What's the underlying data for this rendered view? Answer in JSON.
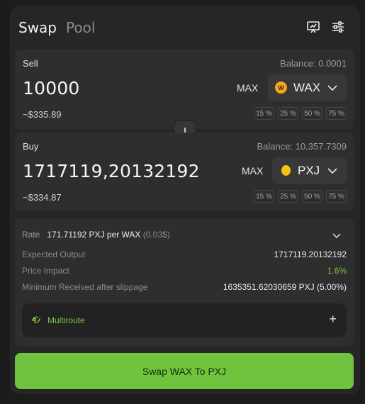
{
  "header": {
    "tab_swap": "Swap",
    "tab_pool": "Pool",
    "icons": [
      "chart-icon",
      "settings-icon"
    ]
  },
  "sell": {
    "label": "Sell",
    "balance": "Balance: 0.0001",
    "amount": "10000",
    "usd": "~$335.89",
    "max": "MAX",
    "token": "WAX",
    "token_icon_text": "W",
    "token_color": "#f5a623",
    "percents": [
      "15 %",
      "25 %",
      "50 %",
      "75 %"
    ]
  },
  "buy": {
    "label": "Buy",
    "balance": "Balance: 10,357.7309",
    "amount": "1717119,20132192",
    "usd": "~$334.87",
    "max": "MAX",
    "token": "PXJ",
    "token_color": "#f3c316",
    "percents": [
      "15 %",
      "25 %",
      "50 %",
      "75 %"
    ]
  },
  "details": {
    "rate_label": "Rate",
    "rate_value": "171.71192 PXJ per WAX",
    "rate_usd": "(0.03$)",
    "expected_label": "Expected Output",
    "expected_value": "1717119.20132192",
    "impact_label": "Price Impact",
    "impact_value": "1.6%",
    "min_label": "Minimum Received after slippage",
    "min_value": "1635351.62030659 PXJ (5.00%)",
    "multiroute": "Multiroute",
    "plus": "+"
  },
  "swap_button": "Swap WAX To PXJ",
  "colors": {
    "accent": "#6fc33e",
    "positive": "#7ec245",
    "panel": "#2e2e2e",
    "background": "#262626"
  }
}
